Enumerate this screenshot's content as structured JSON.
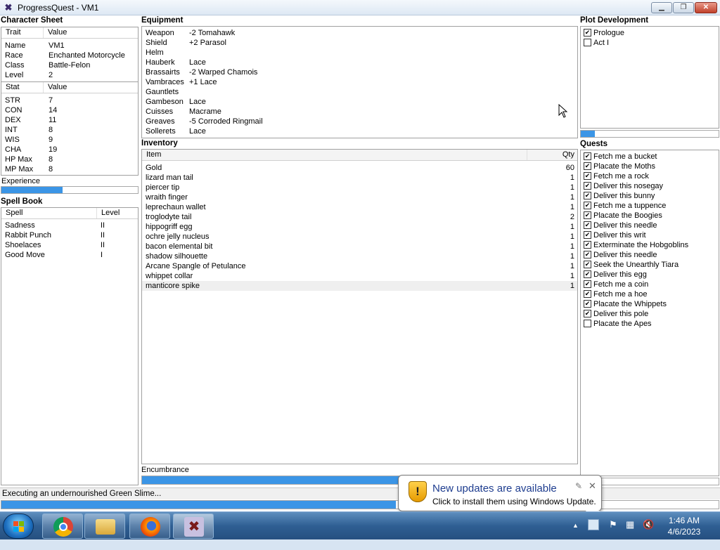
{
  "window": {
    "title": "ProgressQuest - VM1",
    "min": "▁",
    "max": "❐",
    "close": "✕"
  },
  "character_sheet": {
    "header": "Character Sheet",
    "columns": [
      "Trait",
      "Value"
    ],
    "traits": [
      {
        "k": "Name",
        "v": "VM1"
      },
      {
        "k": "Race",
        "v": "Enchanted Motorcycle"
      },
      {
        "k": "Class",
        "v": "Battle-Felon"
      },
      {
        "k": "Level",
        "v": "2"
      }
    ],
    "stat_columns": [
      "Stat",
      "Value"
    ],
    "stats": [
      {
        "k": "STR",
        "v": "7"
      },
      {
        "k": "CON",
        "v": "14"
      },
      {
        "k": "DEX",
        "v": "11"
      },
      {
        "k": "INT",
        "v": "8"
      },
      {
        "k": "WIS",
        "v": "9"
      },
      {
        "k": "CHA",
        "v": "19"
      },
      {
        "k": "HP Max",
        "v": "8"
      },
      {
        "k": "MP Max",
        "v": "8"
      }
    ],
    "experience_label": "Experience",
    "experience_progress": 0.45
  },
  "spell_book": {
    "header": "Spell Book",
    "columns": [
      "Spell",
      "Level"
    ],
    "spells": [
      {
        "k": "Sadness",
        "v": "II"
      },
      {
        "k": "Rabbit Punch",
        "v": "II"
      },
      {
        "k": "Shoelaces",
        "v": "II"
      },
      {
        "k": "Good Move",
        "v": "I"
      }
    ]
  },
  "equipment": {
    "header": "Equipment",
    "items": [
      {
        "k": "Weapon",
        "v": "-2 Tomahawk"
      },
      {
        "k": "Shield",
        "v": "+2 Parasol"
      },
      {
        "k": "Helm",
        "v": ""
      },
      {
        "k": "Hauberk",
        "v": "Lace"
      },
      {
        "k": "Brassairts",
        "v": "-2 Warped Chamois"
      },
      {
        "k": "Vambraces",
        "v": "+1 Lace"
      },
      {
        "k": "Gauntlets",
        "v": ""
      },
      {
        "k": "Gambeson",
        "v": "Lace"
      },
      {
        "k": "Cuisses",
        "v": "Macrame"
      },
      {
        "k": "Greaves",
        "v": "-5 Corroded Ringmail"
      },
      {
        "k": "Sollerets",
        "v": "Lace"
      }
    ]
  },
  "inventory": {
    "header": "Inventory",
    "columns": [
      "Item",
      "Qty"
    ],
    "items": [
      {
        "k": "Gold",
        "v": "60"
      },
      {
        "k": "lizard man tail",
        "v": "1"
      },
      {
        "k": "piercer tip",
        "v": "1"
      },
      {
        "k": "wraith finger",
        "v": "1"
      },
      {
        "k": "leprechaun wallet",
        "v": "1"
      },
      {
        "k": "troglodyte tail",
        "v": "2"
      },
      {
        "k": "hippogriff egg",
        "v": "1"
      },
      {
        "k": "ochre jelly nucleus",
        "v": "1"
      },
      {
        "k": "bacon elemental bit",
        "v": "1"
      },
      {
        "k": "shadow silhouette",
        "v": "1"
      },
      {
        "k": "Arcane Spangle of Petulance",
        "v": "1"
      },
      {
        "k": "whippet collar",
        "v": "1"
      },
      {
        "k": "manticore spike",
        "v": "1"
      }
    ],
    "encumbrance_label": "Encumbrance",
    "encumbrance_progress": 0.95
  },
  "plot": {
    "header": "Plot Development",
    "acts": [
      {
        "label": "Prologue",
        "checked": true
      },
      {
        "label": "Act I",
        "checked": false
      }
    ],
    "progress": 0.1
  },
  "quests": {
    "header": "Quests",
    "items": [
      {
        "label": "Fetch me a bucket",
        "checked": true
      },
      {
        "label": "Placate the Moths",
        "checked": true
      },
      {
        "label": "Fetch me a rock",
        "checked": true
      },
      {
        "label": "Deliver this nosegay",
        "checked": true
      },
      {
        "label": "Deliver this bunny",
        "checked": true
      },
      {
        "label": "Fetch me a tuppence",
        "checked": true
      },
      {
        "label": "Placate the Boogies",
        "checked": true
      },
      {
        "label": "Deliver this needle",
        "checked": true
      },
      {
        "label": "Deliver this writ",
        "checked": true
      },
      {
        "label": "Exterminate the Hobgoblins",
        "checked": true
      },
      {
        "label": "Deliver this needle",
        "checked": true
      },
      {
        "label": "Seek the Unearthly Tiara",
        "checked": true
      },
      {
        "label": "Deliver this egg",
        "checked": true
      },
      {
        "label": "Fetch me a coin",
        "checked": true
      },
      {
        "label": "Fetch me a hoe",
        "checked": true
      },
      {
        "label": "Placate the Whippets",
        "checked": true
      },
      {
        "label": "Deliver this pole",
        "checked": true
      },
      {
        "label": "Placate the Apes",
        "checked": false
      }
    ]
  },
  "status": {
    "text": "Executing an undernourished Green Slime...",
    "progress": 0.55
  },
  "notification": {
    "title": "New updates are available",
    "subtitle": "Click to install them using Windows Update.",
    "warn_glyph": "!",
    "pin_glyph": "✎",
    "close_glyph": "✕"
  },
  "taskbar": {
    "time": "1:46 AM",
    "date": "4/6/2023",
    "apps": [
      "chrome-icon",
      "file-explorer-icon",
      "firefox-icon",
      "progressquest-icon"
    ]
  },
  "colors": {
    "progress_fill": "#3b95e6"
  }
}
